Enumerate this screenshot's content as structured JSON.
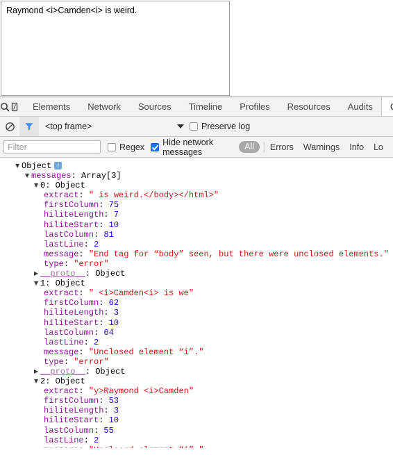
{
  "page": {
    "textarea_value": "Raymond <i>Camden<i> is weird.",
    "textarea_placeholder": ""
  },
  "devtools": {
    "toolbar_icons": [
      {
        "name": "inspect-element-icon",
        "glyph": "search"
      },
      {
        "name": "device-toolbar-icon",
        "glyph": "device"
      }
    ],
    "tabs": [
      {
        "label": "Elements",
        "selected": false
      },
      {
        "label": "Network",
        "selected": false
      },
      {
        "label": "Sources",
        "selected": false
      },
      {
        "label": "Timeline",
        "selected": false
      },
      {
        "label": "Profiles",
        "selected": false
      },
      {
        "label": "Resources",
        "selected": false
      },
      {
        "label": "Audits",
        "selected": false
      },
      {
        "label": "Console",
        "selected": true
      }
    ],
    "frame_row": {
      "clear_icon": "clear-console-icon",
      "filter_icon": "filter-toggle-icon",
      "frame_value": "<top frame>",
      "preserve_log_label": "Preserve log",
      "preserve_log_checked": false
    },
    "filter_bar": {
      "filter_placeholder": "Filter",
      "filter_value": "",
      "regex_label": "Regex",
      "regex_checked": false,
      "hide_network_label": "Hide network messages",
      "hide_network_checked": true,
      "levels": [
        {
          "label": "All",
          "selected": true
        },
        {
          "label": "Errors",
          "selected": false
        },
        {
          "label": "Warnings",
          "selected": false
        },
        {
          "label": "Info",
          "selected": false
        },
        {
          "label": "Lo",
          "selected": false
        }
      ]
    },
    "colors": {
      "key": "#881391",
      "string": "#c41a16",
      "number": "#1c00cf",
      "accent_blue": "#1a73e8",
      "toolbar_bg": "#f3f3f3"
    }
  },
  "console": {
    "root": {
      "toggle": "▼",
      "label": "Object",
      "badge": "i"
    },
    "messages_line": {
      "toggle": "▼",
      "key": "messages",
      "value": "Array[3]"
    },
    "items": [
      {
        "toggle": "▼",
        "index_label": "0",
        "type_label": "Object",
        "props": [
          {
            "key": "extract",
            "value": "\" is weird.</body></html>\"",
            "kind": "string"
          },
          {
            "key": "firstColumn",
            "value": "75",
            "kind": "number"
          },
          {
            "key": "hiliteLength",
            "value": "7",
            "kind": "number"
          },
          {
            "key": "hiliteStart",
            "value": "10",
            "kind": "number"
          },
          {
            "key": "lastColumn",
            "value": "81",
            "kind": "number"
          },
          {
            "key": "lastLine",
            "value": "2",
            "kind": "number"
          },
          {
            "key": "message",
            "value": "\"End tag for “body” seen, but there were unclosed elements.\"",
            "kind": "string"
          },
          {
            "key": "type",
            "value": "\"error\"",
            "kind": "string"
          }
        ],
        "proto": {
          "toggle": "▶",
          "key": "__proto__",
          "value": "Object"
        }
      },
      {
        "toggle": "▼",
        "index_label": "1",
        "type_label": "Object",
        "props": [
          {
            "key": "extract",
            "value": "\" <i>Camden<i> is we\"",
            "kind": "string"
          },
          {
            "key": "firstColumn",
            "value": "62",
            "kind": "number"
          },
          {
            "key": "hiliteLength",
            "value": "3",
            "kind": "number"
          },
          {
            "key": "hiliteStart",
            "value": "10",
            "kind": "number"
          },
          {
            "key": "lastColumn",
            "value": "64",
            "kind": "number"
          },
          {
            "key": "lastLine",
            "value": "2",
            "kind": "number"
          },
          {
            "key": "message",
            "value": "\"Unclosed element “i”.\"",
            "kind": "string"
          },
          {
            "key": "type",
            "value": "\"error\"",
            "kind": "string"
          }
        ],
        "proto": {
          "toggle": "▶",
          "key": "__proto__",
          "value": "Object"
        }
      },
      {
        "toggle": "▼",
        "index_label": "2",
        "type_label": "Object",
        "props": [
          {
            "key": "extract",
            "value": "\"y>Raymond <i>Camden\"",
            "kind": "string"
          },
          {
            "key": "firstColumn",
            "value": "53",
            "kind": "number"
          },
          {
            "key": "hiliteLength",
            "value": "3",
            "kind": "number"
          },
          {
            "key": "hiliteStart",
            "value": "10",
            "kind": "number"
          },
          {
            "key": "lastColumn",
            "value": "55",
            "kind": "number"
          },
          {
            "key": "lastLine",
            "value": "2",
            "kind": "number"
          },
          {
            "key": "message",
            "value": "\"Unclosed element “i”.\"",
            "kind": "string"
          }
        ],
        "proto": null
      }
    ]
  }
}
